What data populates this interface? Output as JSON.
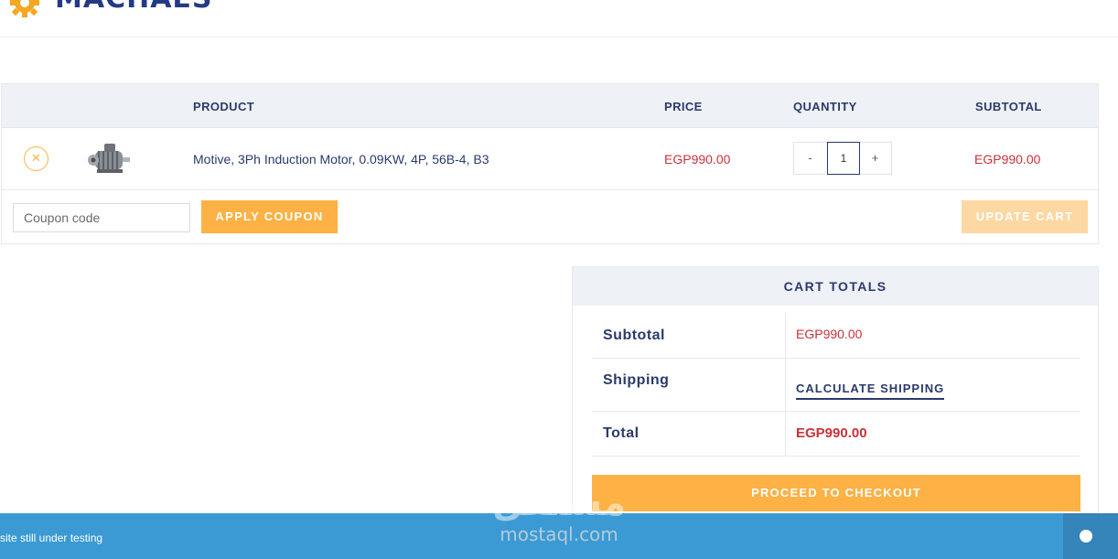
{
  "brand": {
    "logo_text": "MACHAES",
    "logo_color": "#253a84",
    "gear_color": "#f5a623"
  },
  "cart": {
    "headers": {
      "product": "PRODUCT",
      "price": "PRICE",
      "quantity": "QUANTITY",
      "subtotal": "SUBTOTAL"
    },
    "items": [
      {
        "remove_icon": "close-icon",
        "thumbnail": "motor-image",
        "name": "Motive, 3Ph Induction Motor, 0.09KW, 4P, 56B-4, B3",
        "price": "EGP990.00",
        "qty_minus": "-",
        "quantity": "1",
        "qty_plus": "+",
        "subtotal": "EGP990.00"
      }
    ],
    "coupon_placeholder": "Coupon code",
    "apply_coupon_label": "APPLY COUPON",
    "update_cart_label": "UPDATE CART"
  },
  "totals": {
    "title": "CART TOTALS",
    "subtotal_label": "Subtotal",
    "subtotal_value": "EGP990.00",
    "shipping_label": "Shipping",
    "calculate_shipping_label": "CALCULATE SHIPPING",
    "total_label": "Total",
    "total_value": "EGP990.00",
    "checkout_label": "PROCEED TO CHECKOUT"
  },
  "banner": {
    "text": "site still under testing"
  },
  "watermark": {
    "arabic": "مستقل",
    "latin": "mostaql.com"
  },
  "colors": {
    "accent": "#feb144",
    "accent_disabled": "#fed8a3",
    "price": "#c8323b",
    "text": "#2b3a6b",
    "banner": "#3b9ad4"
  }
}
